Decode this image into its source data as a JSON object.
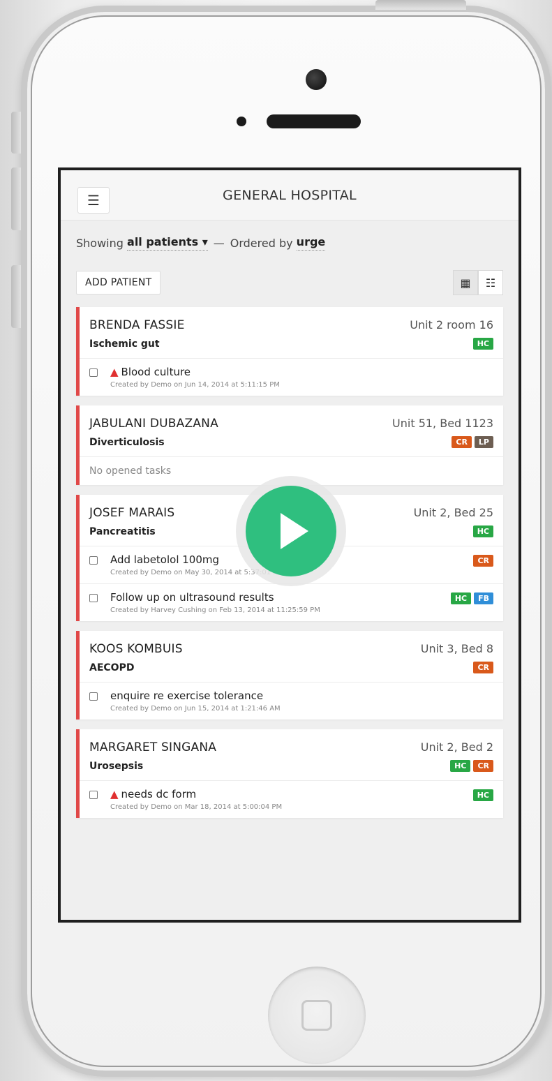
{
  "colors": {
    "accent_red": "#e04848",
    "hc": "#28a745",
    "cr": "#d9591b",
    "lp": "#6d5e52",
    "fb": "#2f8ed8",
    "play": "#2fbf7f"
  },
  "header": {
    "menu_icon": "hamburger-icon",
    "title": "GENERAL HOSPITAL"
  },
  "filter": {
    "showing_label": "Showing",
    "showing_value": "all patients ▾",
    "sep": "—",
    "ordered_label": "Ordered by",
    "ordered_value": "urge"
  },
  "toolbar": {
    "add_label": "ADD PATIENT",
    "view_grid_icon": "grid-view-icon",
    "view_list_icon": "list-view-icon"
  },
  "patients": [
    {
      "name": "BRENDA FASSIE",
      "location": "Unit 2 room 16",
      "diagnosis": "Ischemic gut",
      "badges": [
        "HC"
      ],
      "tasks": [
        {
          "title": "Blood culture",
          "warn": true,
          "meta": "Created by Demo on Jun 14, 2014 at 5:11:15 PM",
          "badges": []
        }
      ]
    },
    {
      "name": "JABULANI DUBAZANA",
      "location": "Unit 51, Bed 1123",
      "diagnosis": "Diverticulosis",
      "badges": [
        "CR",
        "LP"
      ],
      "empty": "No opened tasks"
    },
    {
      "name": "JOSEF MARAIS",
      "location": "Unit 2, Bed 25",
      "diagnosis": "Pancreatitis",
      "badges": [
        "HC"
      ],
      "tasks": [
        {
          "title": "Add labetolol 100mg",
          "warn": false,
          "meta": "Created by Demo on May 30, 2014 at 5:37:01 PM",
          "badges": [
            "CR"
          ]
        },
        {
          "title": "Follow up on ultrasound results",
          "warn": false,
          "meta": "Created by Harvey Cushing on Feb 13, 2014 at 11:25:59 PM",
          "badges": [
            "HC",
            "FB"
          ]
        }
      ]
    },
    {
      "name": "KOOS KOMBUIS",
      "location": "Unit 3, Bed 8",
      "diagnosis": "AECOPD",
      "badges": [
        "CR"
      ],
      "tasks": [
        {
          "title": "enquire re exercise tolerance",
          "warn": false,
          "meta": "Created by Demo on Jun 15, 2014 at 1:21:46 AM",
          "badges": []
        }
      ]
    },
    {
      "name": "MARGARET SINGANA",
      "location": "Unit 2, Bed 2",
      "diagnosis": "Urosepsis",
      "badges": [
        "HC",
        "CR"
      ],
      "tasks": [
        {
          "title": "needs dc form",
          "warn": true,
          "meta": "Created by Demo on Mar 18, 2014 at 5:00:04 PM",
          "badges": [
            "HC"
          ]
        }
      ]
    }
  ],
  "overlay": {
    "icon": "play-icon"
  }
}
